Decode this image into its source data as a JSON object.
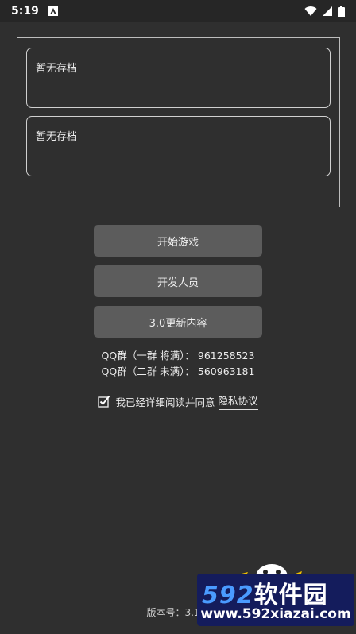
{
  "status_bar": {
    "time": "5:19",
    "icons": [
      "app-notification-icon",
      "wifi-icon",
      "signal-icon",
      "battery-icon"
    ]
  },
  "save_slots": [
    {
      "label": "暂无存档"
    },
    {
      "label": "暂无存档"
    }
  ],
  "buttons": {
    "start": "开始游戏",
    "developers": "开发人员",
    "update": "3.0更新内容"
  },
  "qq_groups": [
    "QQ群（一群 将满）： 961258523",
    "QQ群（二群 未满）： 560963181"
  ],
  "agreement": {
    "checked": true,
    "text": "我已经详细阅读并同意",
    "link": "隐私协议"
  },
  "version": "-- 版本号：3.1",
  "watermark": {
    "number": "592",
    "brand": "软件园",
    "url": "www.592xiazai.com"
  },
  "colors": {
    "background": "#2f2f2f",
    "button": "#5c5c5c",
    "watermark_bg": "#141c5c",
    "watermark_accent": "#3b8ef5"
  }
}
